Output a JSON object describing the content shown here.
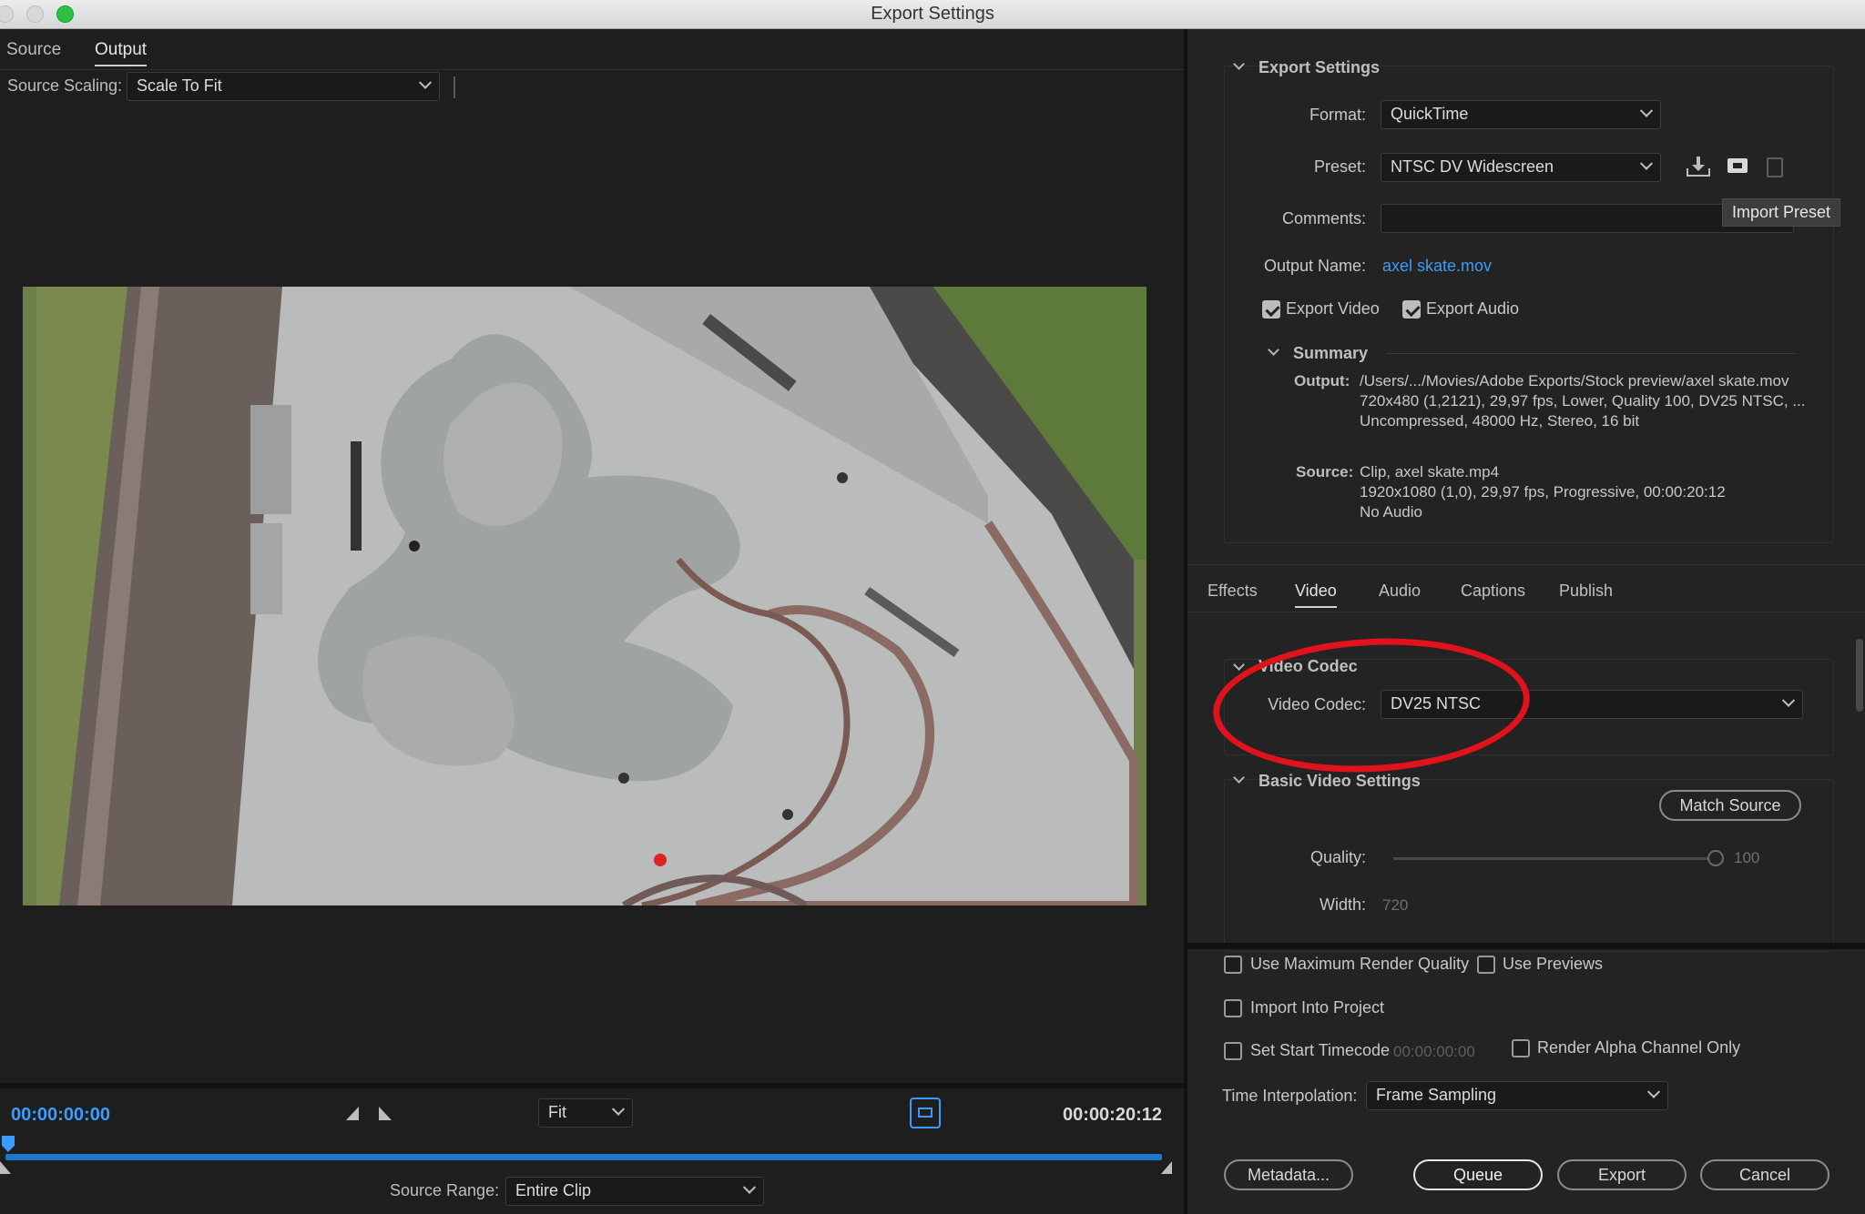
{
  "window": {
    "title": "Export Settings"
  },
  "left": {
    "tabs": [
      "Source",
      "Output"
    ],
    "source_scaling_label": "Source Scaling:",
    "source_scaling_value": "Scale To Fit",
    "timecode_start": "00:00:00:00",
    "timecode_end": "00:00:20:12",
    "zoom_value": "Fit",
    "source_range_label": "Source Range:",
    "source_range_value": "Entire Clip"
  },
  "export_settings": {
    "section_title": "Export Settings",
    "format_label": "Format:",
    "format_value": "QuickTime",
    "preset_label": "Preset:",
    "preset_value": "NTSC DV Widescreen",
    "comments_label": "Comments:",
    "tooltip": "Import Preset",
    "output_name_label": "Output Name:",
    "output_name_value": "axel skate.mov",
    "export_video_label": "Export Video",
    "export_audio_label": "Export Audio",
    "summary_title": "Summary",
    "output_label": "Output:",
    "output_lines": [
      "/Users/.../Movies/Adobe Exports/Stock preview/axel skate.mov",
      "720x480 (1,2121), 29,97 fps, Lower, Quality 100, DV25 NTSC, ...",
      "Uncompressed, 48000 Hz, Stereo, 16 bit"
    ],
    "source_label": "Source:",
    "source_lines": [
      "Clip, axel skate.mp4",
      "1920x1080 (1,0), 29,97 fps, Progressive, 00:00:20:12",
      "No Audio"
    ]
  },
  "tabs": [
    "Effects",
    "Video",
    "Audio",
    "Captions",
    "Publish"
  ],
  "video": {
    "codec_section_title": "Video Codec",
    "codec_label": "Video Codec:",
    "codec_value": "DV25 NTSC",
    "basic_section_title": "Basic Video Settings",
    "match_source_label": "Match Source",
    "quality_label": "Quality:",
    "quality_value": "100",
    "width_label": "Width:",
    "width_value": "720"
  },
  "bottom": {
    "max_render_label": "Use Maximum Render Quality",
    "use_previews_label": "Use Previews",
    "import_project_label": "Import Into Project",
    "start_timecode_label": "Set Start Timecode",
    "start_timecode_value": "00:00:00:00",
    "alpha_label": "Render Alpha Channel Only",
    "time_interp_label": "Time Interpolation:",
    "time_interp_value": "Frame Sampling",
    "metadata_label": "Metadata...",
    "queue_label": "Queue",
    "export_label": "Export",
    "cancel_label": "Cancel"
  },
  "colors": {
    "accent_blue": "#3b9cff",
    "annotation_red": "#e0121b",
    "link_blue": "#3e9bf5"
  }
}
